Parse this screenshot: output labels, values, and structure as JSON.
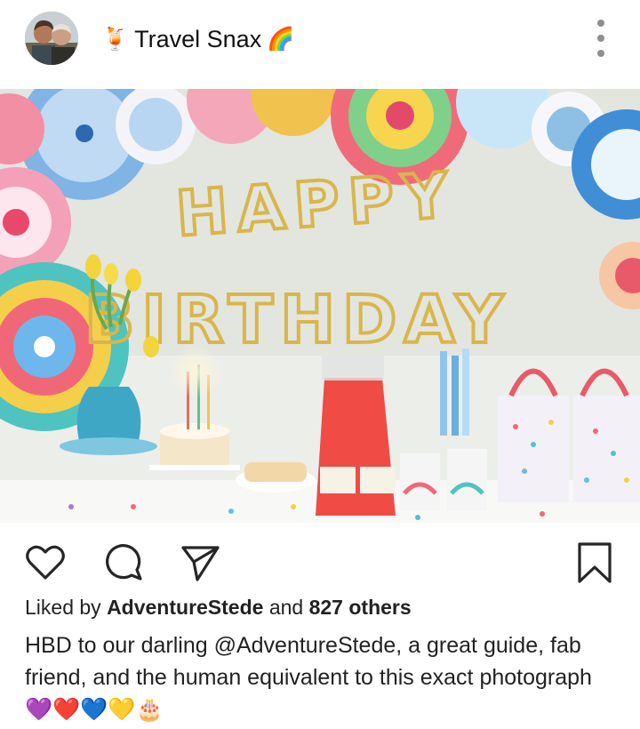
{
  "post": {
    "account_name": "Travel Snax",
    "account_emoji_left": "🍹",
    "account_emoji_right": "🌈",
    "photo_banner_top": "HAPPY",
    "photo_banner_bottom": "BIRTHDAY"
  },
  "likes": {
    "prefix": "Liked by",
    "user": "AdventureStede",
    "middle": "and",
    "others": "827 others"
  },
  "caption": {
    "text": "HBD to our darling @AdventureStede, a great guide, fab friend, and the human equivalent to this exact photograph",
    "emojis": "💜❤️💙💛🎂"
  },
  "icons": {
    "like": "heart-icon",
    "comment": "comment-bubble-icon",
    "share": "paper-plane-icon",
    "save": "bookmark-icon",
    "menu": "vertical-ellipsis-icon"
  },
  "colors": {
    "text": "#262626",
    "icon": "#262626",
    "menu_dots": "#8e8e8e"
  }
}
